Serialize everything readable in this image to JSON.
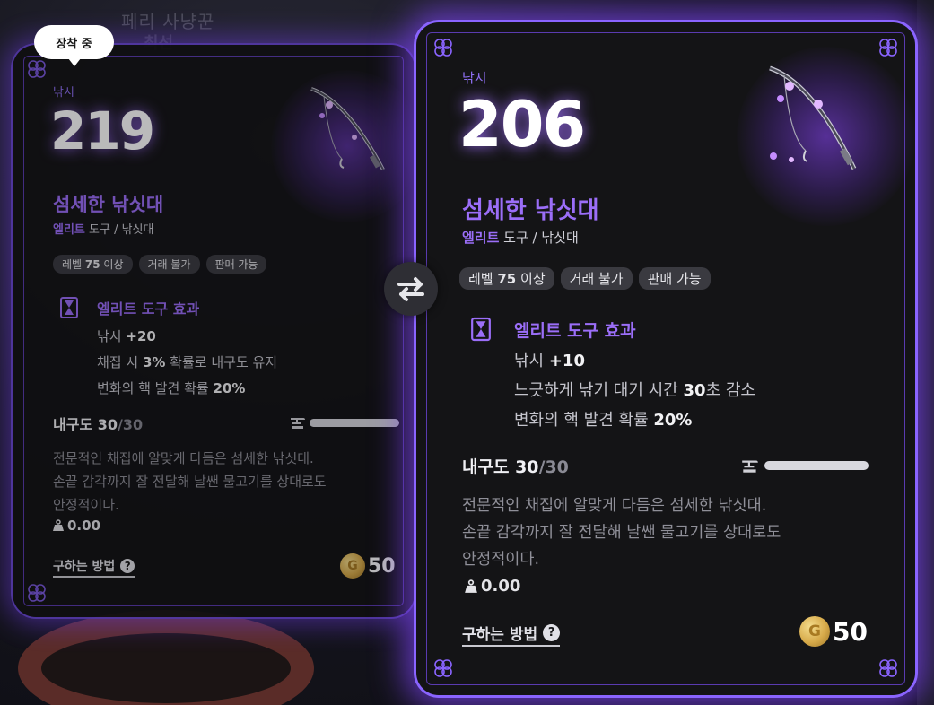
{
  "background": {
    "title_line1": "페리 사냥꾼",
    "title_line2": "최선"
  },
  "tooltip": {
    "label": "장착 중"
  },
  "left_card": {
    "category": "낚시",
    "power": "219",
    "name": "섬세한 낚싯대",
    "grade": "엘리트",
    "type": " 도구 / 낚싯대",
    "tags": [
      {
        "prefix": "레벨 ",
        "value": "75",
        "suffix": " 이상"
      },
      {
        "prefix": "거래 불가",
        "value": "",
        "suffix": ""
      },
      {
        "prefix": "판매 가능",
        "value": "",
        "suffix": ""
      }
    ],
    "effect_title": "엘리트 도구 효과",
    "effects": [
      {
        "text": "낚시 ",
        "value": "+20",
        "suffix": ""
      },
      {
        "text": "채집 시 ",
        "value": "3%",
        "suffix": " 확률로 내구도 유지"
      },
      {
        "text": "변화의 핵 발견 확률 ",
        "value": "20%",
        "suffix": ""
      }
    ],
    "durability_label": "내구도 ",
    "durability_current": "30",
    "durability_max": "/30",
    "durability_fraction": 1.0,
    "description": [
      "전문적인 채집에 알맞게 다듬은 섬세한 낚싯대.",
      "손끝 감각까지 잘 전달해 날쌘 물고기를 상대로도",
      "안정적이다."
    ],
    "weight": "0.00",
    "how_to_obtain": "구하는 방법",
    "price": "50"
  },
  "right_card": {
    "category": "낚시",
    "power": "206",
    "name": "섬세한 낚싯대",
    "grade": "엘리트",
    "type": " 도구 / 낚싯대",
    "tags": [
      {
        "prefix": "레벨 ",
        "value": "75",
        "suffix": " 이상"
      },
      {
        "prefix": "거래 불가",
        "value": "",
        "suffix": ""
      },
      {
        "prefix": "판매 가능",
        "value": "",
        "suffix": ""
      }
    ],
    "effect_title": "엘리트 도구 효과",
    "effects": [
      {
        "text": "낚시 ",
        "value": "+10",
        "suffix": ""
      },
      {
        "text": "느긋하게 낚기 대기 시간 ",
        "value": "30",
        "suffix": "초 감소"
      },
      {
        "text": "변화의 핵 발견 확률 ",
        "value": "20%",
        "suffix": ""
      }
    ],
    "durability_label": "내구도 ",
    "durability_current": "30",
    "durability_max": "/30",
    "durability_fraction": 1.0,
    "description": [
      "전문적인 채집에 알맞게 다듬은 섬세한 낚싯대.",
      "손끝 감각까지 잘 전달해 날쌘 물고기를 상대로도",
      "안정적이다."
    ],
    "weight": "0.00",
    "how_to_obtain": "구하는 방법",
    "price": "50"
  },
  "icons": {
    "swap": "swap-arrows-icon",
    "effect": "hourglass-card-icon",
    "durability": "anvil-icon",
    "weight": "weight-icon",
    "help": "question-circle-icon",
    "coin": "gold-coin-icon",
    "corner": "ornament-corner-icon",
    "item": "fishing-rod-icon"
  },
  "colors": {
    "accent_purple": "#9b6ef8",
    "frame_purple": "#8a64ff",
    "card_bg": "#141416",
    "coin_gold": "#d7aa4a"
  }
}
